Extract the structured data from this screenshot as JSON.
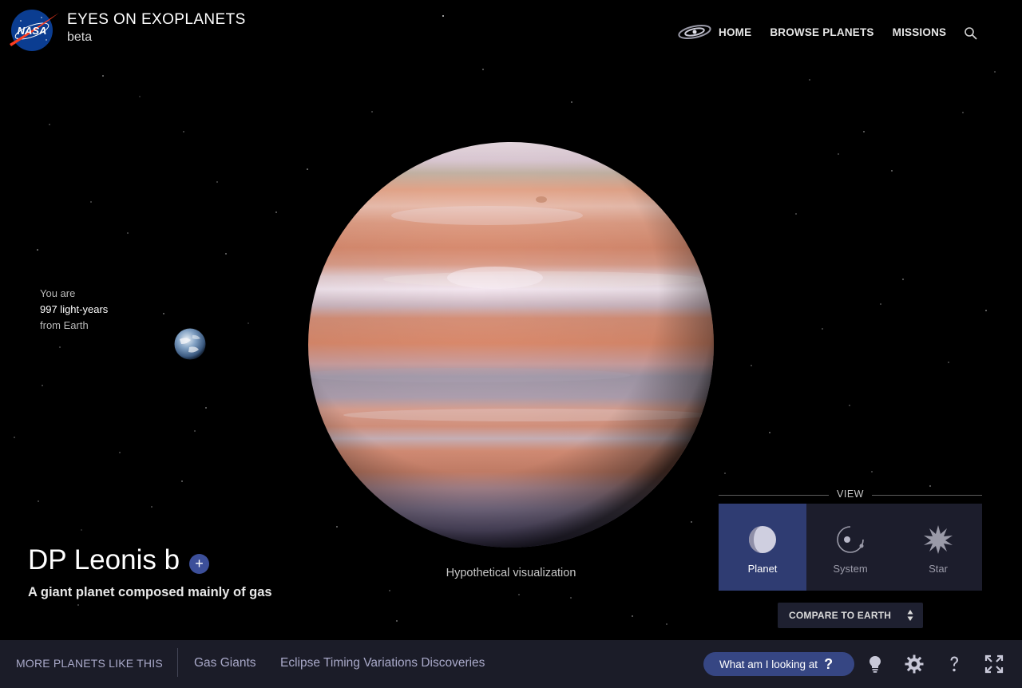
{
  "header": {
    "app_title": "EYES ON EXOPLANETS",
    "app_subtitle": "beta",
    "logo_text": "NASA",
    "nav": {
      "home": "HOME",
      "browse": "BROWSE PLANETS",
      "missions": "MISSIONS"
    },
    "icons": [
      "galaxy-icon",
      "search-icon"
    ]
  },
  "distance": {
    "line1": "You are",
    "line2": "997 light-years",
    "line3": "from Earth"
  },
  "planet": {
    "name": "DP Leonis b",
    "add_label": "+",
    "description": "A giant planet composed mainly of gas",
    "visualization_note": "Hypothetical visualization"
  },
  "view": {
    "label": "VIEW",
    "options": [
      {
        "label": "Planet",
        "icon": "planet-icon",
        "active": true
      },
      {
        "label": "System",
        "icon": "system-icon",
        "active": false
      },
      {
        "label": "Star",
        "icon": "star-icon",
        "active": false
      }
    ],
    "compare_label": "COMPARE TO EARTH"
  },
  "bottom_bar": {
    "more_label": "MORE PLANETS LIKE THIS",
    "tags": [
      "Gas Giants",
      "Eclipse Timing Variations Discoveries"
    ],
    "what_label": "What am I looking at",
    "what_q": "?",
    "icons": [
      "lightbulb-icon",
      "gear-icon",
      "help-icon",
      "fullscreen-icon"
    ]
  },
  "colors": {
    "accent": "#364683",
    "active_view": "#2f3c72",
    "bar_bg": "#1b1c28",
    "tag_text": "#a9a9c9"
  }
}
